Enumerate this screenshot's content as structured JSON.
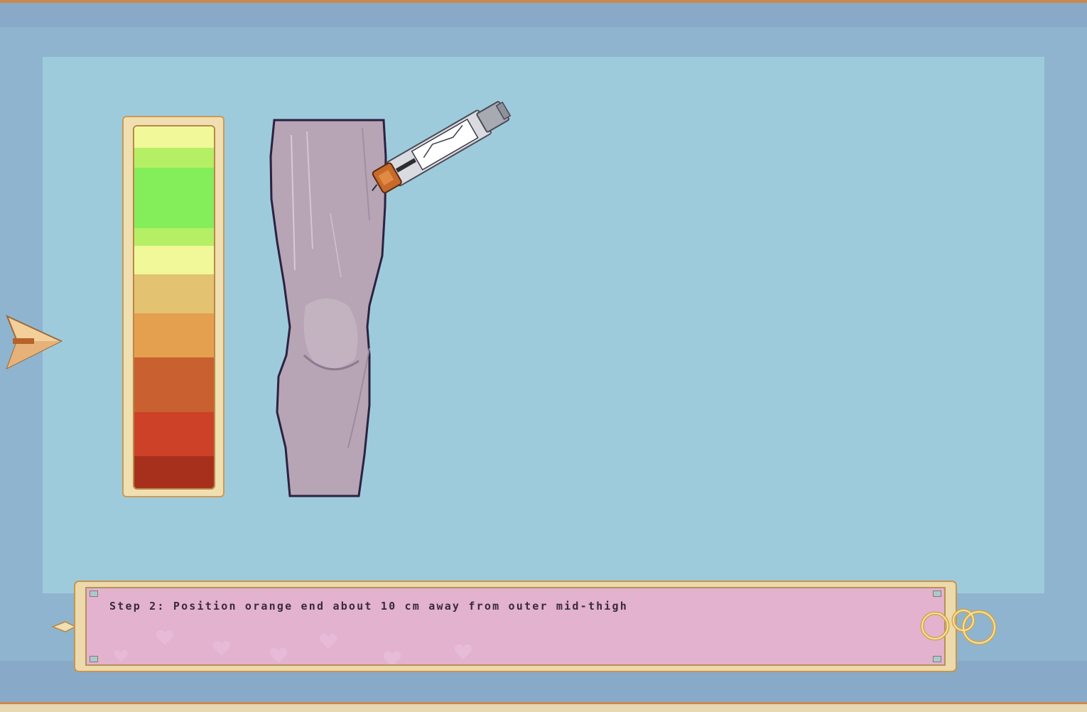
{
  "dialog": {
    "text": "Step 2: Position orange end about 10 cm away from outer mid-thigh"
  },
  "icons": {
    "nav_arrow": "arrow-cursor-icon",
    "leg": "leg-illustration",
    "injector": "auto-injector-icon"
  },
  "meter": {
    "bands": [
      "#f1f89a",
      "#b5ef66",
      "#84ed5a",
      "#b5ef66",
      "#f1f89a",
      "#e3c272",
      "#e4a04f",
      "#c9602f",
      "#cc4127",
      "#a7301d"
    ]
  },
  "colors": {
    "background": "#8fb4cf",
    "play_area": "#9ecbdc",
    "dialog_fill": "#e2b2cf",
    "dialog_frame": "#ecd9ac"
  }
}
